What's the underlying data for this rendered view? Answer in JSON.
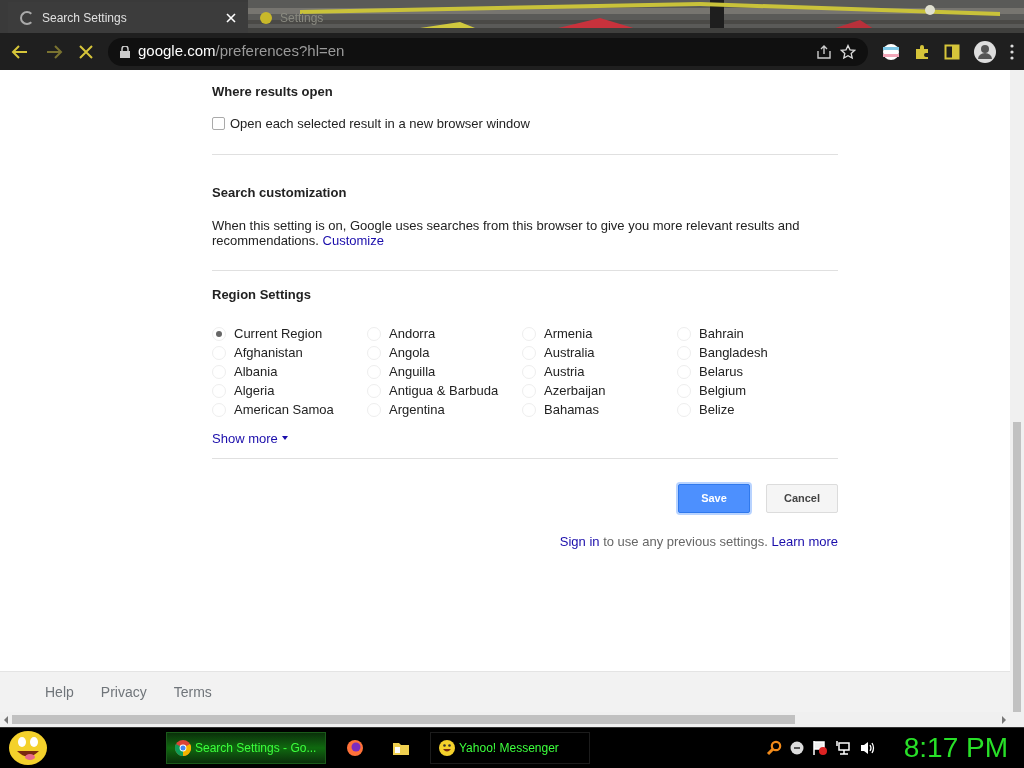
{
  "browser": {
    "tabs": [
      {
        "title": "Search Settings",
        "selected": true
      },
      {
        "title": "Settings",
        "selected": false
      }
    ],
    "address": {
      "host": "google.com",
      "path": "/preferences?hl=en"
    }
  },
  "results_open": {
    "heading": "Where results open",
    "option": {
      "label": "Open each selected result in a new browser window",
      "checked": false
    }
  },
  "customization": {
    "heading": "Search customization",
    "text": "When this setting is on, Google uses searches from this browser to give you more relevant results and recommendations.",
    "link": "Customize"
  },
  "region": {
    "heading": "Region Settings",
    "columns": [
      [
        {
          "label": "Current Region",
          "selected": true
        },
        {
          "label": "Afghanistan",
          "selected": false
        },
        {
          "label": "Albania",
          "selected": false
        },
        {
          "label": "Algeria",
          "selected": false
        },
        {
          "label": "American Samoa",
          "selected": false
        }
      ],
      [
        {
          "label": "Andorra",
          "selected": false
        },
        {
          "label": "Angola",
          "selected": false
        },
        {
          "label": "Anguilla",
          "selected": false
        },
        {
          "label": "Antigua & Barbuda",
          "selected": false
        },
        {
          "label": "Argentina",
          "selected": false
        }
      ],
      [
        {
          "label": "Armenia",
          "selected": false
        },
        {
          "label": "Australia",
          "selected": false
        },
        {
          "label": "Austria",
          "selected": false
        },
        {
          "label": "Azerbaijan",
          "selected": false
        },
        {
          "label": "Bahamas",
          "selected": false
        }
      ],
      [
        {
          "label": "Bahrain",
          "selected": false
        },
        {
          "label": "Bangladesh",
          "selected": false
        },
        {
          "label": "Belarus",
          "selected": false
        },
        {
          "label": "Belgium",
          "selected": false
        },
        {
          "label": "Belize",
          "selected": false
        }
      ]
    ],
    "show_more": "Show more"
  },
  "buttons": {
    "save": "Save",
    "cancel": "Cancel"
  },
  "signin": {
    "link": "Sign in",
    "text": "to use any previous settings.",
    "learn": "Learn more"
  },
  "footer": [
    "Help",
    "Privacy",
    "Terms"
  ],
  "taskbar": {
    "items": [
      {
        "label": "Search Settings - Go...",
        "kind": "chrome",
        "selected": true
      },
      {
        "kind": "firefox",
        "selected": false
      },
      {
        "kind": "folder",
        "selected": false
      },
      {
        "label": "Yahoo! Messenger",
        "kind": "messenger",
        "selected": false
      }
    ],
    "clock": "8:17 PM"
  }
}
